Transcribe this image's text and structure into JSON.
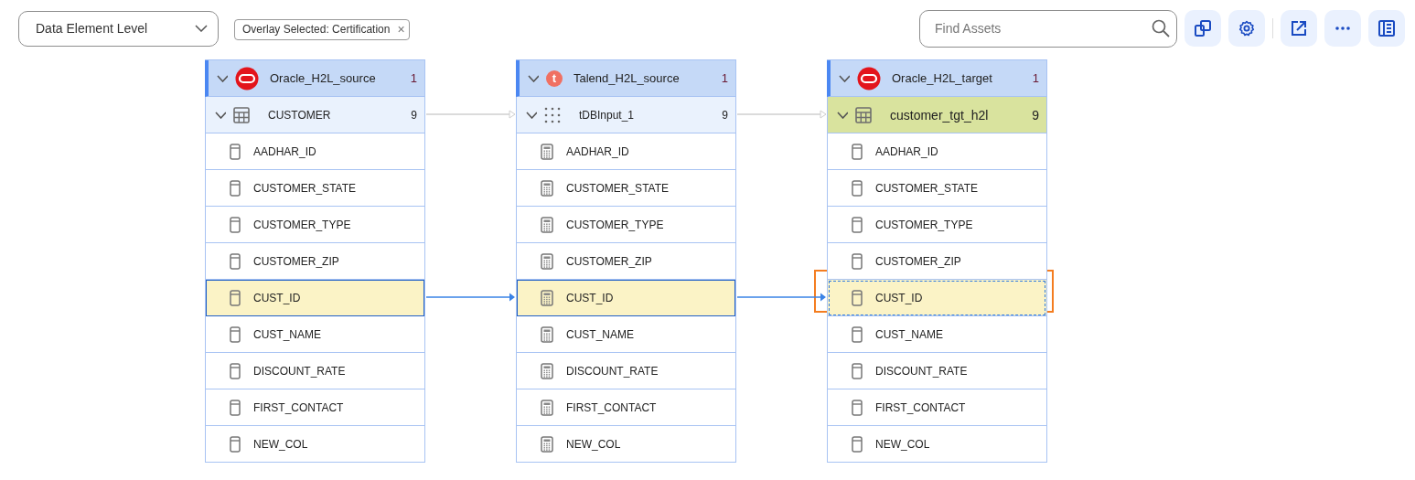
{
  "toolbar": {
    "level_select": {
      "value": "Data Element Level"
    },
    "overlay_chip": {
      "label": "Overlay Selected: Certification",
      "close": "×"
    },
    "search": {
      "placeholder": "Find Assets"
    },
    "buttons": [
      {
        "kind": "copy"
      },
      {
        "kind": "settings"
      },
      {
        "kind": "divider"
      },
      {
        "kind": "open"
      },
      {
        "kind": "more"
      },
      {
        "kind": "panel"
      }
    ]
  },
  "lineage": {
    "nodes": [
      {
        "source": {
          "name": "Oracle_H2L_source",
          "kind": "oracle",
          "count": "1",
          "expanded": true
        },
        "table": {
          "name": "CUSTOMER",
          "kind": "table",
          "count": "9",
          "expanded": true,
          "highlighted": false
        },
        "fields": [
          {
            "name": "AADHAR_ID",
            "kind": "column",
            "selected": false,
            "focused": false
          },
          {
            "name": "CUSTOMER_STATE",
            "kind": "column",
            "selected": false,
            "focused": false
          },
          {
            "name": "CUSTOMER_TYPE",
            "kind": "column",
            "selected": false,
            "focused": false
          },
          {
            "name": "CUSTOMER_ZIP",
            "kind": "column",
            "selected": false,
            "focused": false
          },
          {
            "name": "CUST_ID",
            "kind": "column",
            "selected": true,
            "focused": false
          },
          {
            "name": "CUST_NAME",
            "kind": "column",
            "selected": false,
            "focused": false
          },
          {
            "name": "DISCOUNT_RATE",
            "kind": "column",
            "selected": false,
            "focused": false
          },
          {
            "name": "FIRST_CONTACT",
            "kind": "column",
            "selected": false,
            "focused": false
          },
          {
            "name": "NEW_COL",
            "kind": "column",
            "selected": false,
            "focused": false
          }
        ]
      },
      {
        "source": {
          "name": "Talend_H2L_source",
          "kind": "talend",
          "logo_text": "t",
          "count": "1",
          "expanded": true
        },
        "table": {
          "name": "tDBInput_1",
          "kind": "dots",
          "count": "9",
          "expanded": true,
          "highlighted": false
        },
        "fields": [
          {
            "name": "AADHAR_ID",
            "kind": "calc",
            "selected": false,
            "focused": false
          },
          {
            "name": "CUSTOMER_STATE",
            "kind": "calc",
            "selected": false,
            "focused": false
          },
          {
            "name": "CUSTOMER_TYPE",
            "kind": "calc",
            "selected": false,
            "focused": false
          },
          {
            "name": "CUSTOMER_ZIP",
            "kind": "calc",
            "selected": false,
            "focused": false
          },
          {
            "name": "CUST_ID",
            "kind": "calc",
            "selected": true,
            "focused": false
          },
          {
            "name": "CUST_NAME",
            "kind": "calc",
            "selected": false,
            "focused": false
          },
          {
            "name": "DISCOUNT_RATE",
            "kind": "calc",
            "selected": false,
            "focused": false
          },
          {
            "name": "FIRST_CONTACT",
            "kind": "calc",
            "selected": false,
            "focused": false
          },
          {
            "name": "NEW_COL",
            "kind": "calc",
            "selected": false,
            "focused": false
          }
        ]
      },
      {
        "source": {
          "name": "Oracle_H2L_target",
          "kind": "oracle",
          "count": "1",
          "expanded": true
        },
        "table": {
          "name": "customer_tgt_h2l",
          "kind": "table",
          "count": "9",
          "expanded": true,
          "highlighted": true
        },
        "fields": [
          {
            "name": "AADHAR_ID",
            "kind": "column",
            "selected": false,
            "focused": false
          },
          {
            "name": "CUSTOMER_STATE",
            "kind": "column",
            "selected": false,
            "focused": false
          },
          {
            "name": "CUSTOMER_TYPE",
            "kind": "column",
            "selected": false,
            "focused": false
          },
          {
            "name": "CUSTOMER_ZIP",
            "kind": "column",
            "selected": false,
            "focused": false
          },
          {
            "name": "CUST_ID",
            "kind": "column",
            "selected": false,
            "focused": true
          },
          {
            "name": "CUST_NAME",
            "kind": "column",
            "selected": false,
            "focused": false
          },
          {
            "name": "DISCOUNT_RATE",
            "kind": "column",
            "selected": false,
            "focused": false
          },
          {
            "name": "FIRST_CONTACT",
            "kind": "column",
            "selected": false,
            "focused": false
          },
          {
            "name": "NEW_COL",
            "kind": "column",
            "selected": false,
            "focused": false
          }
        ]
      }
    ]
  }
}
